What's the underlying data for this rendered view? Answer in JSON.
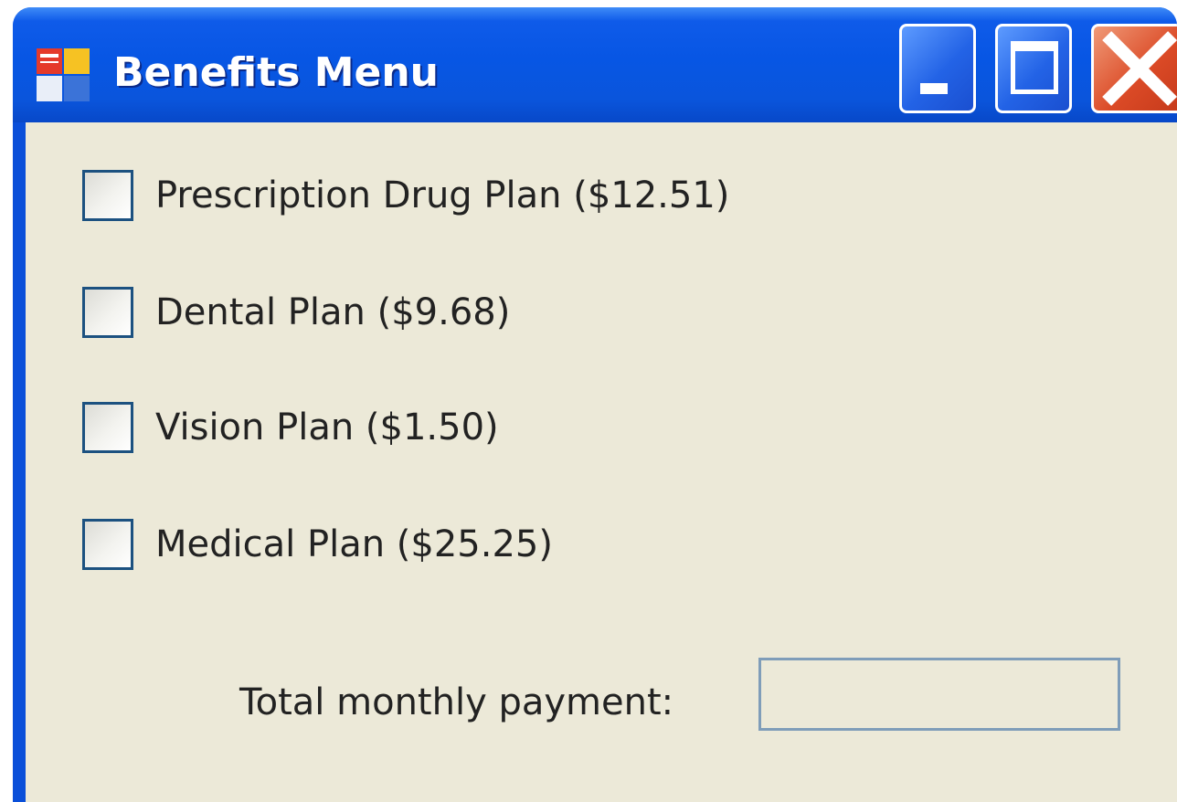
{
  "window": {
    "title": "Benefits Menu",
    "icon": "windows-forms-app-icon",
    "controls": [
      "minimize-icon",
      "maximize-icon",
      "close-icon"
    ]
  },
  "options": [
    {
      "label": "Prescription Drug Plan ($12.51)",
      "checked": false
    },
    {
      "label": "Dental Plan ($9.68)",
      "checked": false
    },
    {
      "label": "Vision Plan ($1.50)",
      "checked": false
    },
    {
      "label": "Medical Plan ($25.25)",
      "checked": false
    }
  ],
  "total": {
    "label": "Total monthly payment:",
    "value": ""
  },
  "colors": {
    "titlebar": "#0756e4",
    "client": "#ece9d8",
    "close_button": "#db4a26"
  }
}
